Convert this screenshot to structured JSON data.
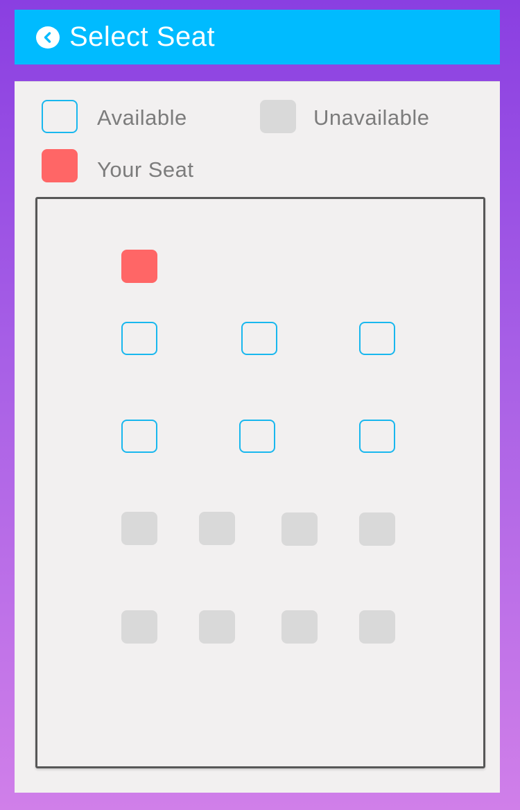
{
  "header": {
    "title": "Select Seat",
    "back_icon": "chevron-left-circle-icon"
  },
  "legend": {
    "available_label": "Available",
    "unavailable_label": "Unavailable",
    "your_seat_label": "Your Seat"
  },
  "colors": {
    "header_bg": "#00bbff",
    "available_border": "#18b7ee",
    "unavailable_fill": "#d9d9d9",
    "your_seat_fill": "#ff6666",
    "background_gradient_top": "#8a3fe1",
    "background_gradient_bottom": "#d07fe9"
  },
  "seat_map": {
    "rows": [
      [
        "your_seat"
      ],
      [
        "available",
        "available",
        "available"
      ],
      [
        "available",
        "available",
        "available"
      ],
      [
        "unavailable",
        "unavailable",
        "unavailable",
        "unavailable"
      ],
      [
        "unavailable",
        "unavailable",
        "unavailable",
        "unavailable"
      ]
    ]
  }
}
